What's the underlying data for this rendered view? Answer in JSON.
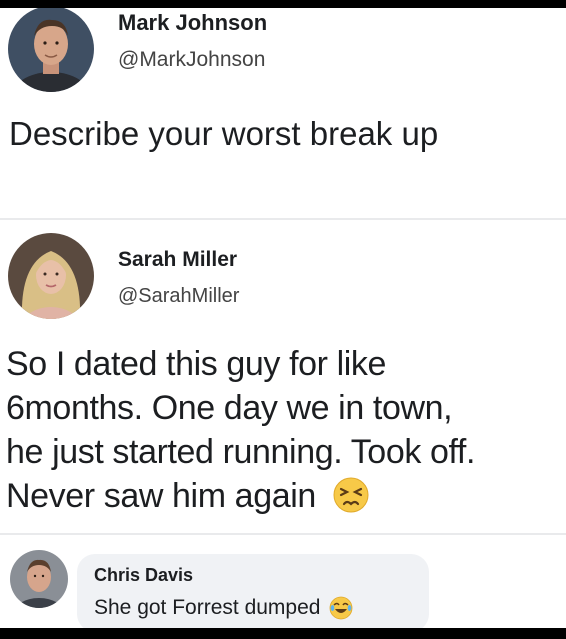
{
  "post1": {
    "author_name": "Mark Johnson",
    "author_handle": "@MarkJohnson",
    "text": "Describe your worst break up"
  },
  "post2": {
    "author_name": "Sarah Miller",
    "author_handle": "@SarahMiller",
    "lines": [
      "So I dated this guy for like",
      "6months. One day we in town,",
      "he just started running. Took off.",
      "Never saw him again"
    ],
    "emoji_icon": "persevering-face-icon"
  },
  "comment": {
    "author_name": "Chris Davis",
    "text": "She got Forrest dumped",
    "emoji_icon": "tears-of-joy-icon"
  },
  "colors": {
    "text": "#1c1e21",
    "handle": "#444444",
    "divider": "#e9eaec",
    "comment_bg": "#f0f2f5",
    "emoji_yellow": "#f7c948"
  }
}
